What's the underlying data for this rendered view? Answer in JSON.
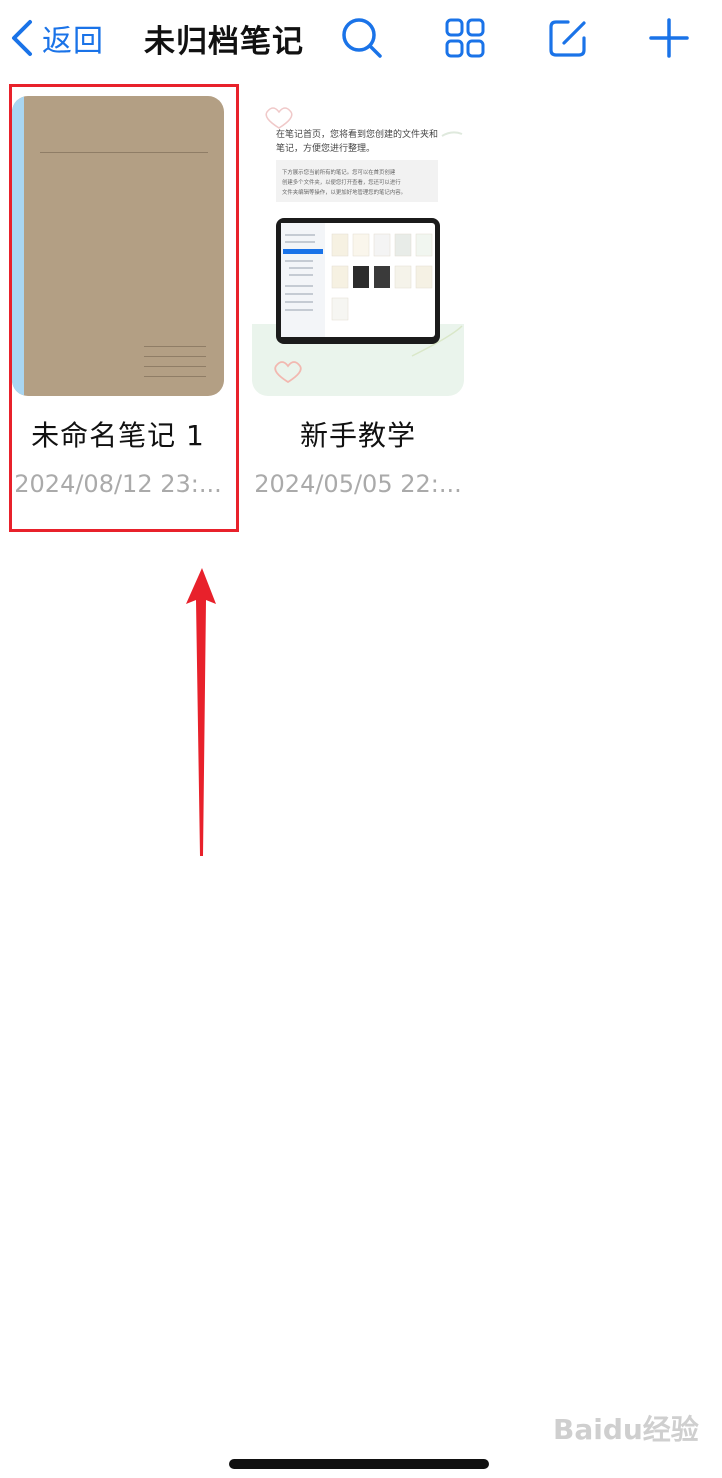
{
  "header": {
    "back_label": "返回",
    "title": "未归档笔记",
    "icons": [
      "search-icon",
      "grid-view-icon",
      "compose-icon",
      "plus-icon"
    ],
    "accent_color": "#1a73e8"
  },
  "notes": [
    {
      "title": "未命名笔记 1",
      "date": "2024/08/12 23:...",
      "cover": "notebook",
      "cover_color": "#b39f84",
      "spine_color": "#a9d6f2"
    },
    {
      "title": "新手教学",
      "date": "2024/05/05 22:...",
      "cover": "tutorial",
      "preview": {
        "line1": "在笔记首页，您将看到您创建的文件夹和",
        "line2": "笔记，方便您进行整理。",
        "box_line1": "下方展示您当前所有的笔记。您可以在首页创建",
        "box_line2": "创建多个文件夹，以便您打开查看，您还可以进行",
        "box_line3": "文件夹编辑等操作，以更加好地管理您的笔记内容。"
      }
    }
  ],
  "annotation": {
    "highlight_color": "#e8212b"
  },
  "watermark": "Baidu经验"
}
